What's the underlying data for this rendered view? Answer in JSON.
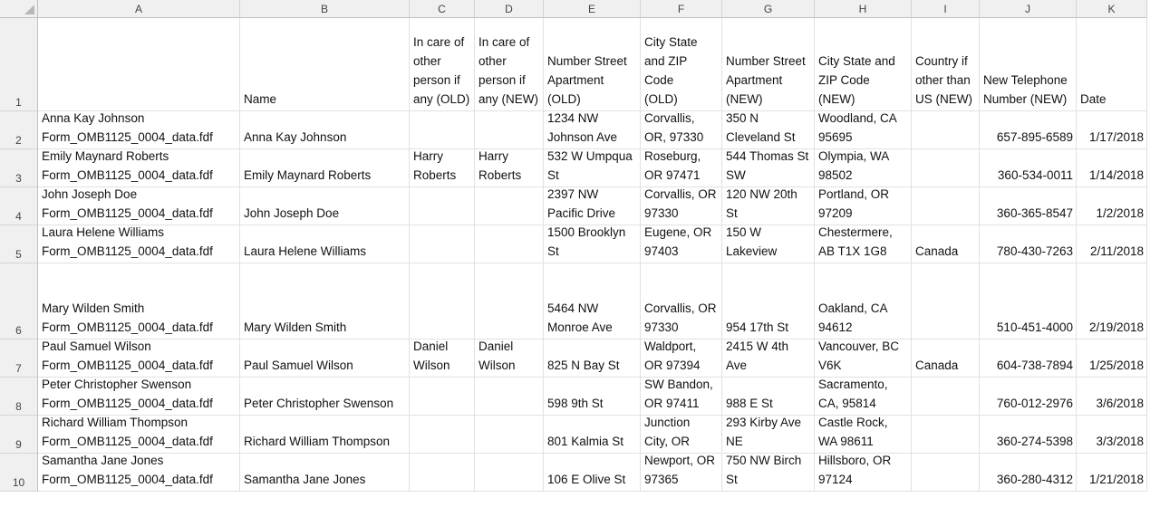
{
  "columns": [
    "A",
    "B",
    "C",
    "D",
    "E",
    "F",
    "G",
    "H",
    "I",
    "J",
    "K"
  ],
  "row_numbers": [
    "1",
    "2",
    "3",
    "4",
    "5",
    "6",
    "7",
    "8",
    "9",
    "10"
  ],
  "header_row": [
    "",
    "Name",
    "In care of\nother\nperson if\nany (OLD)",
    "In care of\nother\nperson if\nany (NEW)",
    "Number Street\nApartment\n(OLD)",
    "City State\nand ZIP Code\n(OLD)",
    "Number Street\nApartment\n(NEW)",
    "City State and\nZIP Code (NEW)",
    "Country if\nother than\nUS (NEW)",
    "New Telephone\nNumber (NEW)",
    "Date"
  ],
  "rows": [
    [
      "Anna Kay Johnson\nForm_OMB1125_0004_data.fdf",
      "Anna Kay Johnson",
      "",
      "",
      "1234 NW\nJohnson Ave",
      "Corvallis,\nOR, 97330",
      "350 N\nCleveland St",
      "Woodland, CA\n95695",
      "",
      "657-895-6589",
      "1/17/2018"
    ],
    [
      "Emily Maynard Roberts\nForm_OMB1125_0004_data.fdf",
      "Emily Maynard Roberts",
      "Harry\nRoberts",
      "Harry\nRoberts",
      "532 W Umpqua\nSt",
      "Roseburg,\nOR 97471",
      "544 Thomas St\nSW",
      "Olympia, WA\n98502",
      "",
      " 360-534-0011",
      "1/14/2018"
    ],
    [
      "John Joseph Doe\nForm_OMB1125_0004_data.fdf",
      "John Joseph Doe",
      "",
      "",
      "2397 NW\nPacific Drive",
      "Corvallis, OR\n97330",
      "120 NW 20th\nSt",
      "Portland, OR\n97209",
      "",
      "360-365-8547",
      "1/2/2018"
    ],
    [
      "Laura Helene Williams\nForm_OMB1125_0004_data.fdf",
      "Laura Helene Williams",
      "",
      "",
      "1500 Brooklyn\nSt",
      "Eugene, OR\n97403",
      "150 W\nLakeview",
      " Chestermere,\nAB T1X 1G8",
      "Canada",
      "780-430-7263",
      "2/11/2018"
    ],
    [
      "Mary Wilden Smith\nForm_OMB1125_0004_data.fdf",
      "Mary Wilden Smith",
      "",
      "",
      "5464 NW\nMonroe Ave",
      "Corvallis, OR\n97330",
      "954 17th St",
      "Oakland, CA\n94612",
      "",
      "510-451-4000",
      "2/19/2018"
    ],
    [
      "Paul Samuel Wilson\nForm_OMB1125_0004_data.fdf",
      "Paul Samuel Wilson",
      "Daniel\nWilson",
      "Daniel\nWilson",
      "825 N Bay St",
      "Waldport,\nOR 97394",
      "2415 W 4th\nAve",
      " Vancouver, BC\nV6K",
      "Canada",
      "604-738-7894",
      "1/25/2018"
    ],
    [
      "Peter Christopher Swenson\nForm_OMB1125_0004_data.fdf",
      "Peter Christopher Swenson",
      "",
      "",
      "598 9th St",
      "SW Bandon,\nOR 97411",
      "988 E St",
      "Sacramento,\nCA, 95814",
      "",
      "760-012-2976",
      "3/6/2018"
    ],
    [
      "Richard William Thompson\nForm_OMB1125_0004_data.fdf",
      "Richard William Thompson",
      "",
      "",
      "801 Kalmia St",
      "Junction\nCity, OR",
      "293 Kirby Ave\nNE",
      "Castle Rock,\nWA 98611",
      "",
      " 360-274-5398",
      "3/3/2018"
    ],
    [
      "Samantha Jane Jones\nForm_OMB1125_0004_data.fdf",
      "Samantha Jane Jones",
      "",
      "",
      "106 E Olive St",
      "Newport, OR\n97365",
      "750 NW Birch\nSt",
      "Hillsboro, OR\n97124",
      "",
      "360-280-4312",
      "1/21/2018"
    ]
  ]
}
